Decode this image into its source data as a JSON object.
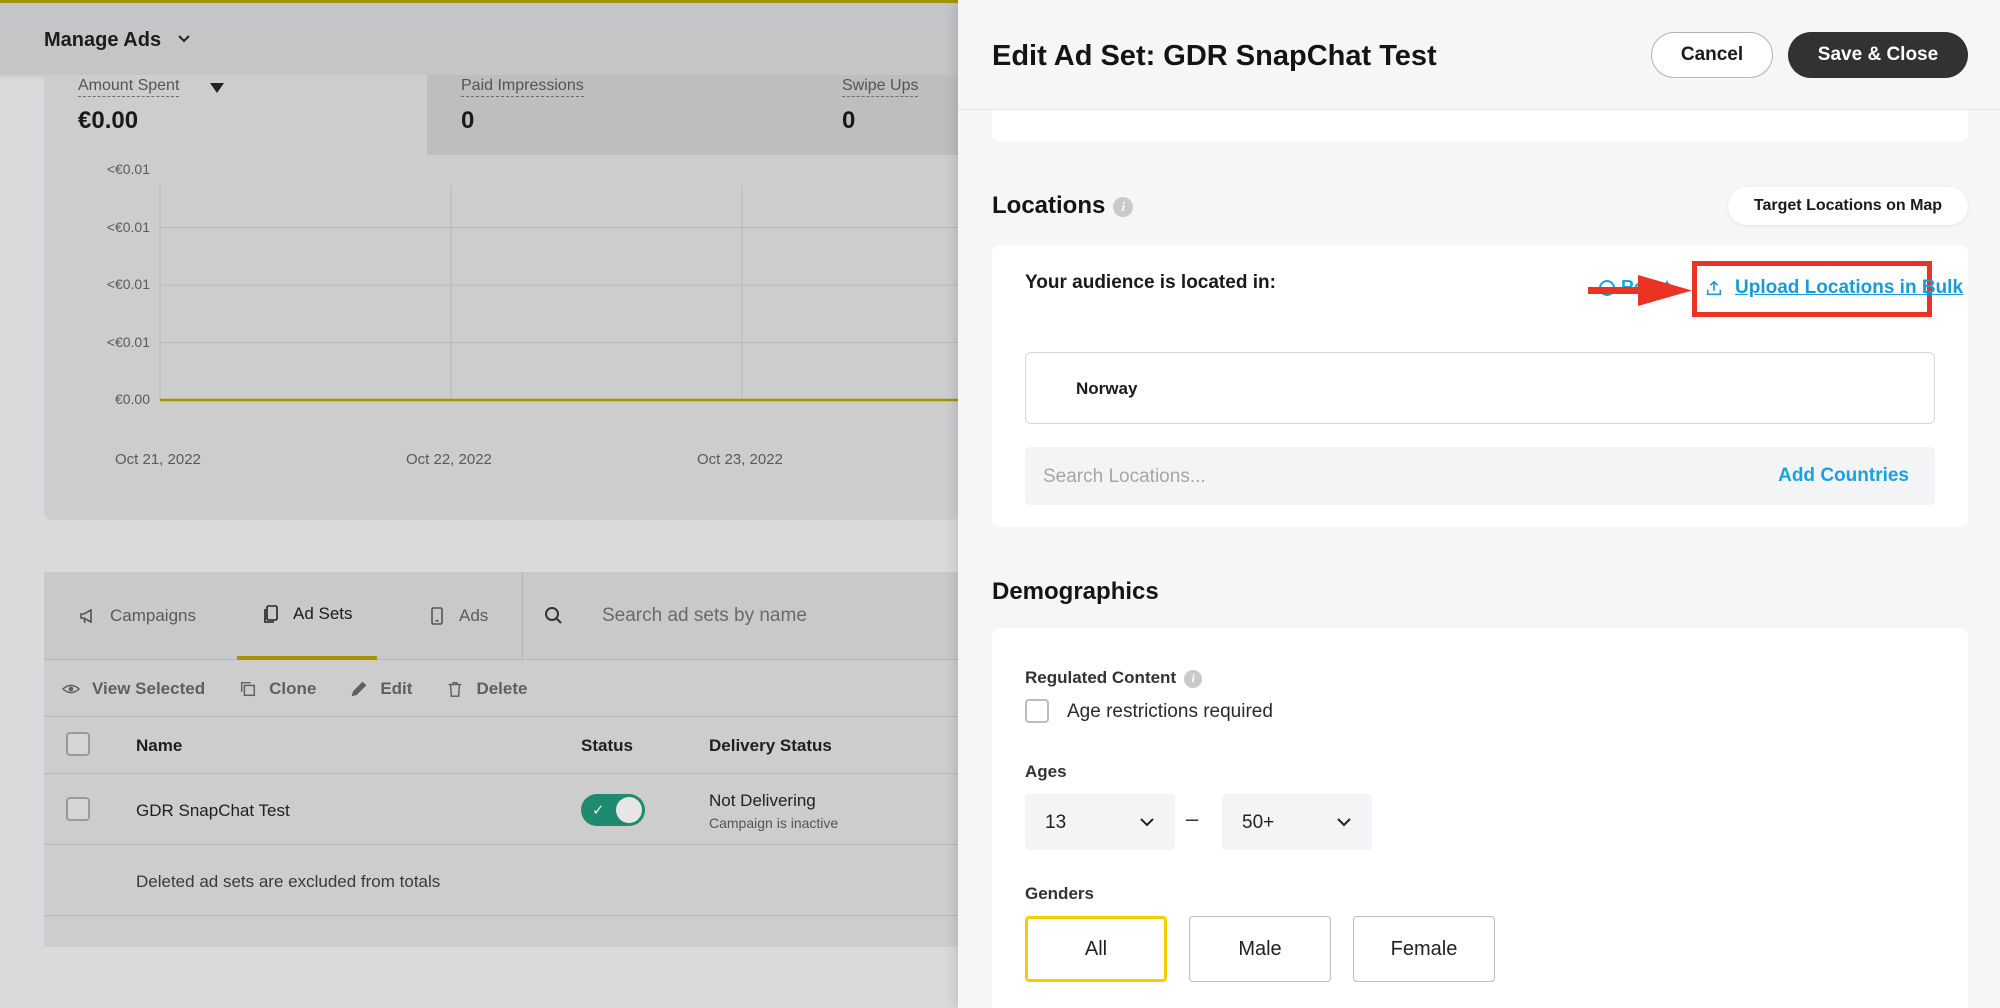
{
  "bg": {
    "header_title": "Manage Ads",
    "metrics": [
      {
        "label": "Amount Spent",
        "value": "€0.00"
      },
      {
        "label": "Paid Impressions",
        "value": "0"
      },
      {
        "label": "Swipe Ups",
        "value": "0"
      }
    ],
    "tabs": [
      "Campaigns",
      "Ad Sets",
      "Ads"
    ],
    "active_tab": "Ad Sets",
    "search_placeholder": "Search ad sets by name",
    "toolbar": [
      "View Selected",
      "Clone",
      "Edit",
      "Delete"
    ],
    "columns": [
      "Name",
      "Status",
      "Delivery Status"
    ],
    "row": {
      "name": "GDR SnapChat Test",
      "status_on": true,
      "delivery": "Not Delivering",
      "delivery_sub": "Campaign is inactive"
    },
    "footer_note": "Deleted ad sets are excluded from totals"
  },
  "chart_data": {
    "type": "line",
    "categories": [
      "Oct 21, 2022",
      "Oct 22, 2022",
      "Oct 23, 2022"
    ],
    "values": [
      0,
      0,
      0
    ],
    "y_tick_labels": [
      "<€0.01",
      "<€0.01",
      "<€0.01",
      "<€0.01",
      "€0.00"
    ],
    "grid": true,
    "line_color": "#a89200"
  },
  "panel": {
    "title": "Edit Ad Set: GDR SnapChat Test",
    "cancel_label": "Cancel",
    "save_label": "Save & Close",
    "locations": {
      "title": "Locations",
      "map_button": "Target Locations on Map",
      "audience_label": "Your audience is located in:",
      "reset_label": "Reset",
      "upload_label": "Upload Locations in Bulk",
      "country": "Norway",
      "search_placeholder": "Search Locations...",
      "add_label": "Add Countries"
    },
    "demographics": {
      "title": "Demographics",
      "regulated_label": "Regulated Content",
      "age_restriction_label": "Age restrictions required",
      "ages_label": "Ages",
      "age_min": "13",
      "age_sep": "–",
      "age_max": "50+",
      "genders_label": "Genders",
      "genders": [
        "All",
        "Male",
        "Female"
      ],
      "selected_gender": "All"
    }
  },
  "colors": {
    "accent_yellow": "#f7cf00",
    "link_blue": "#1aa2e0",
    "highlight_red": "#ea3323",
    "toggle_green": "#1f8a70"
  }
}
